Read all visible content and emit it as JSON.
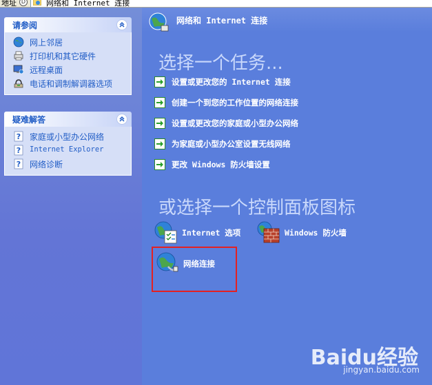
{
  "address_bar": {
    "label": "地址",
    "circle": "D",
    "path": "网络和 Internet 连接"
  },
  "left_panes": [
    {
      "title": "请参阅",
      "items": [
        {
          "label": "网上邻居",
          "icon": "network-neighborhood-icon"
        },
        {
          "label": "打印机和其它硬件",
          "icon": "printer-icon"
        },
        {
          "label": "远程桌面",
          "icon": "remote-desktop-icon"
        },
        {
          "label": "电话和调制解调器选项",
          "icon": "phone-modem-icon"
        }
      ]
    },
    {
      "title": "疑难解答",
      "items": [
        {
          "label": "家庭或小型办公网络",
          "icon": "help-icon"
        },
        {
          "label": "Internet Explorer",
          "icon": "help-icon"
        },
        {
          "label": "网络诊断",
          "icon": "help-icon"
        }
      ]
    }
  ],
  "header": {
    "title": "网络和 Internet 连接"
  },
  "task_section": {
    "title": "选择一个任务...",
    "tasks": [
      "设置或更改您的 Internet 连接",
      "创建一个到您的工作位置的网络连接",
      "设置或更改您的家庭或小型办公网络",
      "为家庭或小型办公室设置无线网络",
      "更改 Windows 防火墙设置"
    ]
  },
  "icon_section": {
    "title": "或选择一个控制面板图标",
    "items": [
      {
        "label": "Internet 选项",
        "icon": "internet-options-icon"
      },
      {
        "label": "Windows 防火墙",
        "icon": "firewall-icon"
      },
      {
        "label": "网络连接",
        "icon": "network-connections-icon"
      }
    ]
  },
  "watermark": {
    "brand": "Baidu经验",
    "url": "jingyan.baidu.com"
  },
  "colors": {
    "accent": "#215dc6",
    "pane_bg": "#5a7edc",
    "highlight": "#e52020"
  }
}
